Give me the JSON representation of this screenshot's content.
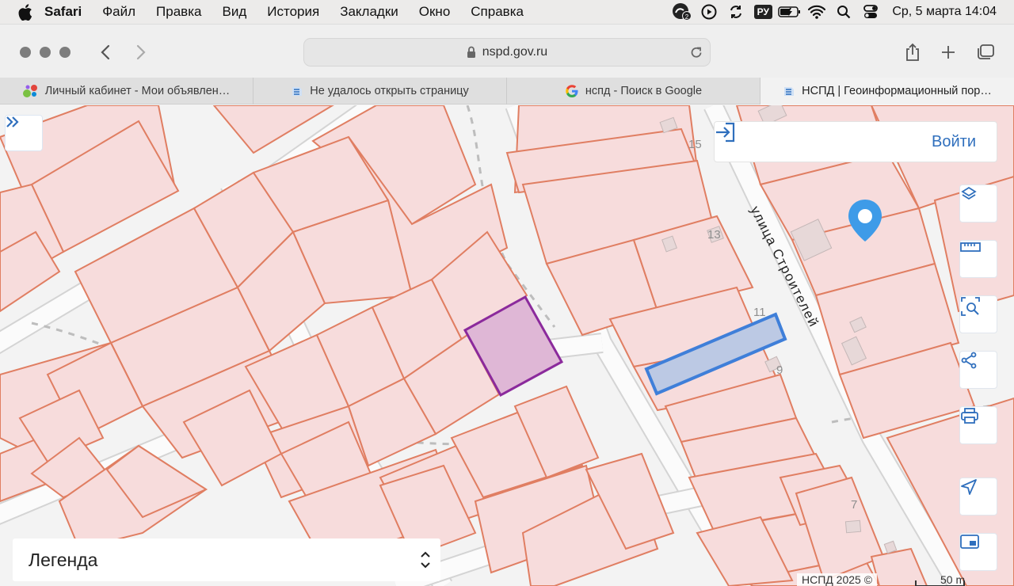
{
  "menubar": {
    "app": "Safari",
    "items": [
      "Файл",
      "Правка",
      "Вид",
      "История",
      "Закладки",
      "Окно",
      "Справка"
    ],
    "badge_count": "2",
    "input_lang": "РУ",
    "clock": "Ср, 5 марта  14:04"
  },
  "toolbar": {
    "url": "nspd.gov.ru"
  },
  "tabs": [
    {
      "label": "Личный кабинет - Мои объявлен…",
      "icon": "avito-icon"
    },
    {
      "label": "Не удалось открыть страницу",
      "icon": "nspd-icon"
    },
    {
      "label": "нспд - Поиск в Google",
      "icon": "google-icon"
    },
    {
      "label": "НСПД | Геоинформационный пор…",
      "icon": "nspd-icon",
      "active": true
    }
  ],
  "map": {
    "login_label": "Войти",
    "street_label": "улица Строителей",
    "house_numbers": [
      "15",
      "13",
      "11",
      "9",
      "7"
    ],
    "legend_label": "Легенда",
    "copyright": "НСПД 2025 ©",
    "scale_label": "50 m",
    "colors": {
      "parcel_fill": "#f7dcdc",
      "parcel_stroke": "#e07e62",
      "selected_purple": "#8b2a9c",
      "selected_blue": "#3f7fd9",
      "accent": "#2f6fbd"
    },
    "tools": [
      "layers-icon",
      "ruler-icon",
      "search-area-icon",
      "share-icon",
      "print-icon",
      "location-icon",
      "minimap-icon"
    ]
  }
}
